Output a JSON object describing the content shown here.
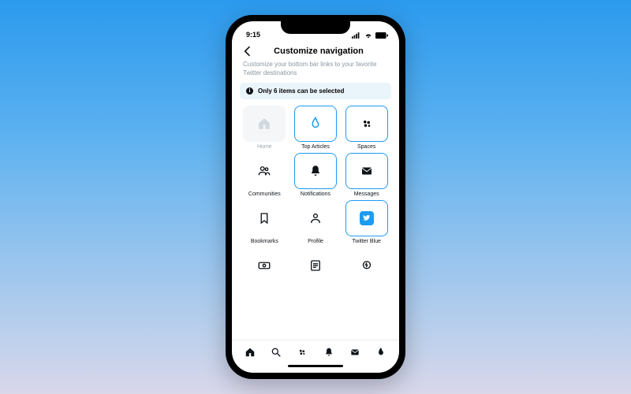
{
  "status": {
    "time": "9:15"
  },
  "header": {
    "title": "Customize navigation"
  },
  "subtitle": "Customize your bottom bar links to your favorite Twitter destinations",
  "banner": {
    "text": "Only 6 items can be selected"
  },
  "items": [
    {
      "label": "Home",
      "state": "disabled"
    },
    {
      "label": "Top Articles",
      "state": "selected"
    },
    {
      "label": "Spaces",
      "state": "selected"
    },
    {
      "label": "Communities",
      "state": "plain"
    },
    {
      "label": "Notifications",
      "state": "selected"
    },
    {
      "label": "Messages",
      "state": "selected"
    },
    {
      "label": "Bookmarks",
      "state": "plain"
    },
    {
      "label": "Profile",
      "state": "plain"
    },
    {
      "label": "Twitter Blue",
      "state": "selected"
    },
    {
      "label": "",
      "state": "plain"
    },
    {
      "label": "",
      "state": "plain"
    },
    {
      "label": "",
      "state": "plain"
    }
  ],
  "tabbar": [
    "home",
    "search",
    "spaces",
    "notifications",
    "messages",
    "toparticles"
  ]
}
